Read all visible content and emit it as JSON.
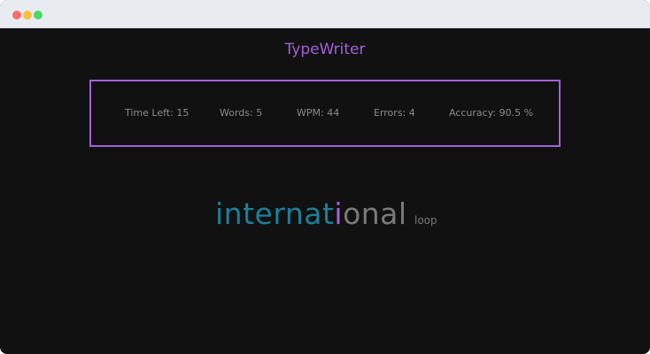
{
  "window": {
    "controls": [
      "close",
      "minimize",
      "maximize"
    ],
    "control_colors": {
      "close": "#ff6b6b",
      "minimize": "#fbbf3c",
      "maximize": "#4cd964"
    }
  },
  "app": {
    "title": "TypeWriter",
    "title_color": "#a35fdc"
  },
  "stats": {
    "border_color": "#a35fdc",
    "time_left": "Time Left: 15",
    "words": "Words: 5",
    "wpm": "WPM: 44",
    "errors": "Errors: 4",
    "accuracy": "Accuracy: 90.5 %"
  },
  "typing": {
    "typed": "internat",
    "current_char": "i",
    "remaining": "onal",
    "next_word": "loop",
    "colors": {
      "typed": "#1c7f98",
      "current": "#a35fdc",
      "remaining": "#7a7a7a"
    }
  }
}
